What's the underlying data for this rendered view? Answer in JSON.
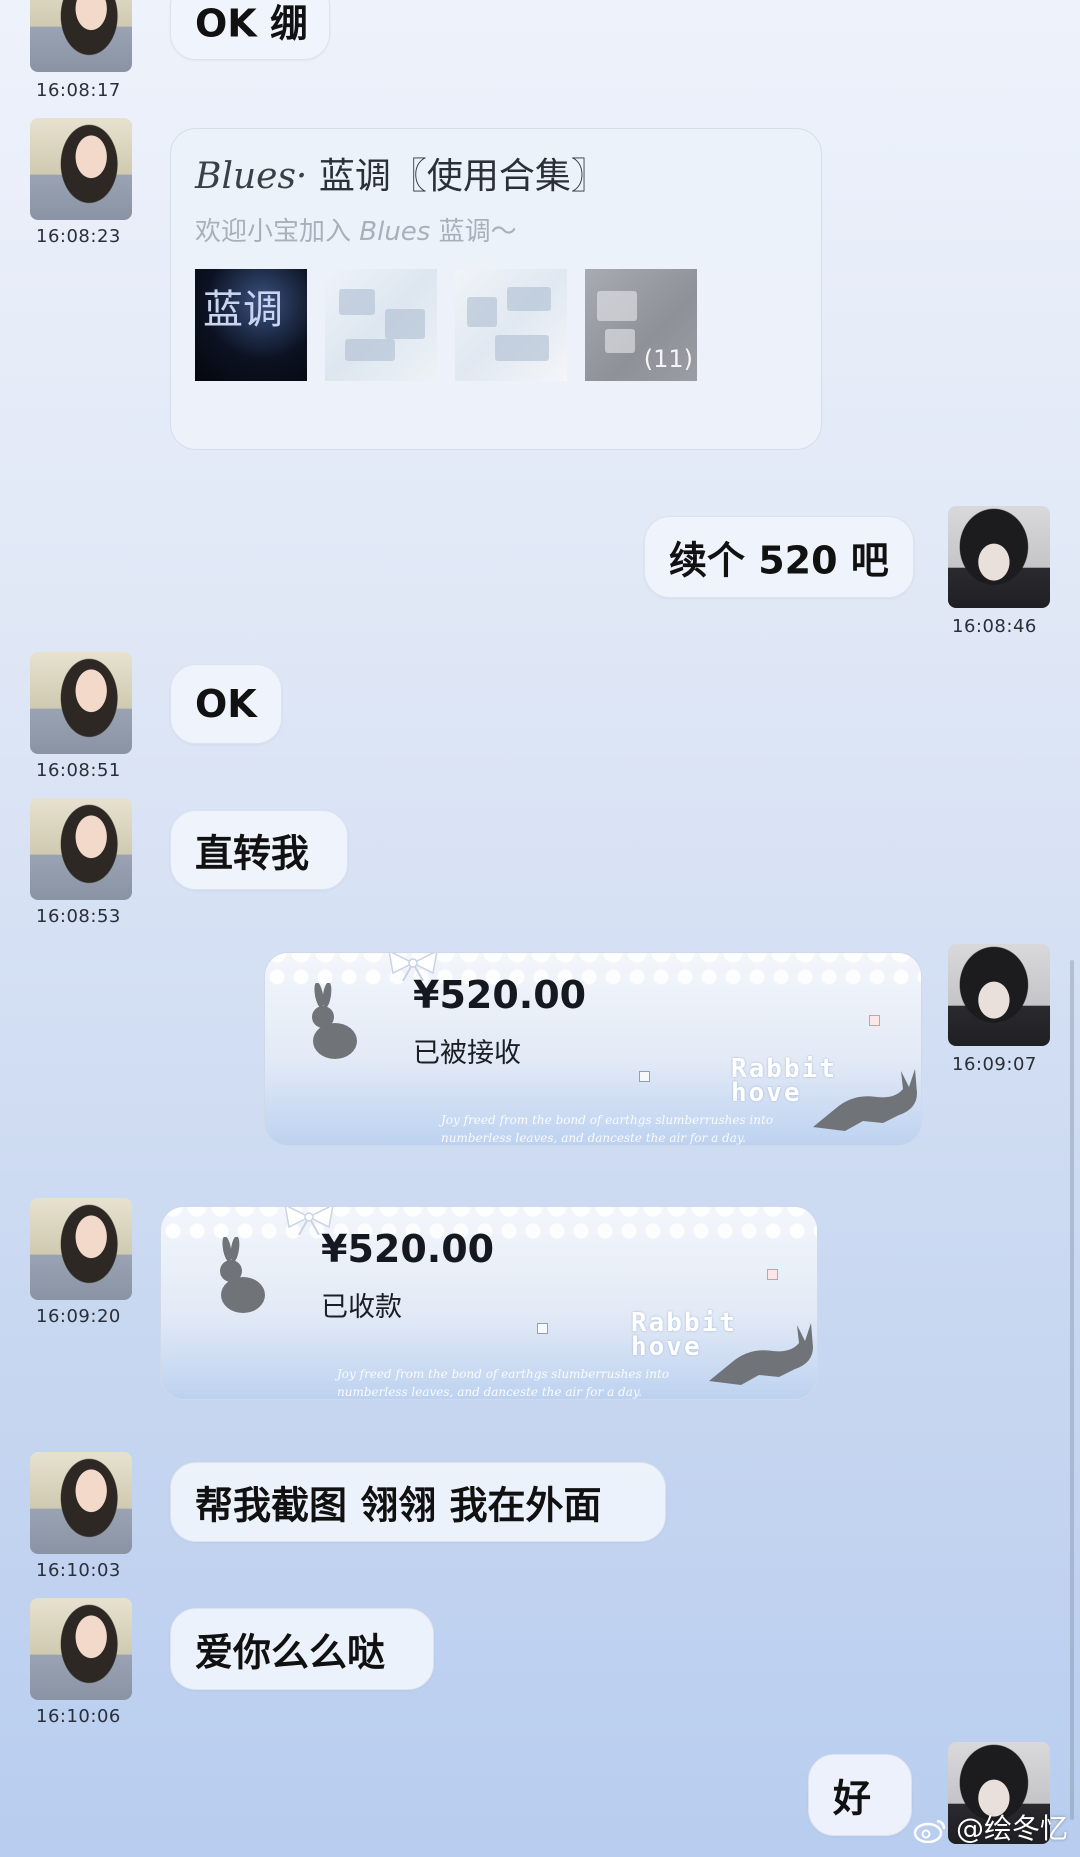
{
  "messages": [
    {
      "side": "left",
      "text": "OK 绷",
      "time": "16:08:17"
    },
    {
      "side": "left",
      "type": "card",
      "time": "16:08:23",
      "card": {
        "title_en": "Blues·",
        "title_zh": " 蓝调〖使用合集〗",
        "sub_pre": "欢迎小宝加入 ",
        "sub_en": "Blues",
        "sub_post": " 蓝调～",
        "thumb1_caption": "蓝调",
        "more_count": "(11)"
      }
    },
    {
      "side": "right",
      "text": "续个 520 吧",
      "time": "16:08:46"
    },
    {
      "side": "left",
      "text": "OK",
      "time": "16:08:51"
    },
    {
      "side": "left",
      "text": "直转我",
      "time": "16:08:53"
    },
    {
      "side": "right",
      "type": "transfer",
      "time": "16:09:07",
      "transfer": {
        "amount": "¥520.00",
        "status": "已被接收",
        "brand_line1": "Rabbit",
        "brand_line2": "hove",
        "poem_line1": "Joy freed from the bond of earthgs slumberrushes into",
        "poem_line2": "numberless leaves, and danceste the air for a day."
      }
    },
    {
      "side": "left",
      "type": "transfer",
      "time": "16:09:20",
      "transfer": {
        "amount": "¥520.00",
        "status": "已收款",
        "brand_line1": "Rabbit",
        "brand_line2": "hove",
        "poem_line1": "Joy freed from the bond of earthgs slumberrushes into",
        "poem_line2": "numberless leaves, and danceste the air for a day."
      }
    },
    {
      "side": "left",
      "text": "帮我截图 翎翎 我在外面",
      "time": "16:10:03"
    },
    {
      "side": "left",
      "text": "爱你么么哒",
      "time": "16:10:06"
    },
    {
      "side": "right",
      "text": "好",
      "time": ""
    }
  ],
  "watermark": "@绘冬忆",
  "colors": {
    "bubble": "#eef2fa",
    "text": "#111111",
    "accent": "#c9d8f1"
  }
}
